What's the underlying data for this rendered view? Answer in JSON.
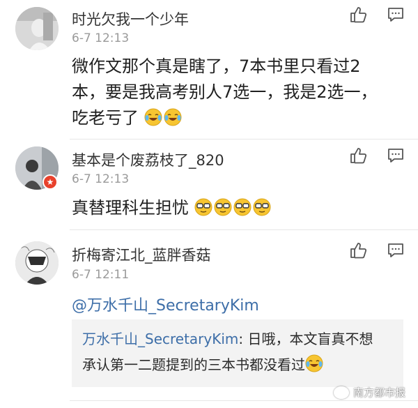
{
  "comments": [
    {
      "username": "时光欠我一个少年",
      "time": "6-7 12:13",
      "content_line1": "微作文那个真是瞎了，7本书里只看过2",
      "content_line2": "本，要是我高考别人7选一，我是2选一，",
      "content_line3": "吃老亏了"
    },
    {
      "username": "基本是个废荔枝了_820",
      "time": "6-7 12:13",
      "content": "真替理科生担忧"
    },
    {
      "username": "折梅寄江北_蓝胖香菇",
      "time": "6-7 12:11",
      "mention": "@万水千山_SecretaryKim",
      "quote_name": "万水千山_SecretaryKim",
      "quote_text_line1": ": 日哦，本文盲真不想",
      "quote_text_line2": "承认第一二题提到的三本书都没看过"
    }
  ],
  "icons": {
    "like": "thumbs-up-icon",
    "reply": "comment-icon",
    "emoji_laugh": "laugh-cry-emoji",
    "emoji_shades": "sunglasses-emoji",
    "badge": "star-badge-icon"
  },
  "watermark": "南方都市报",
  "colors": {
    "link": "#3d6ea8",
    "timestamp": "#9a9a9a",
    "quote_bg": "#f3f3f3",
    "badge": "#e8412c"
  }
}
